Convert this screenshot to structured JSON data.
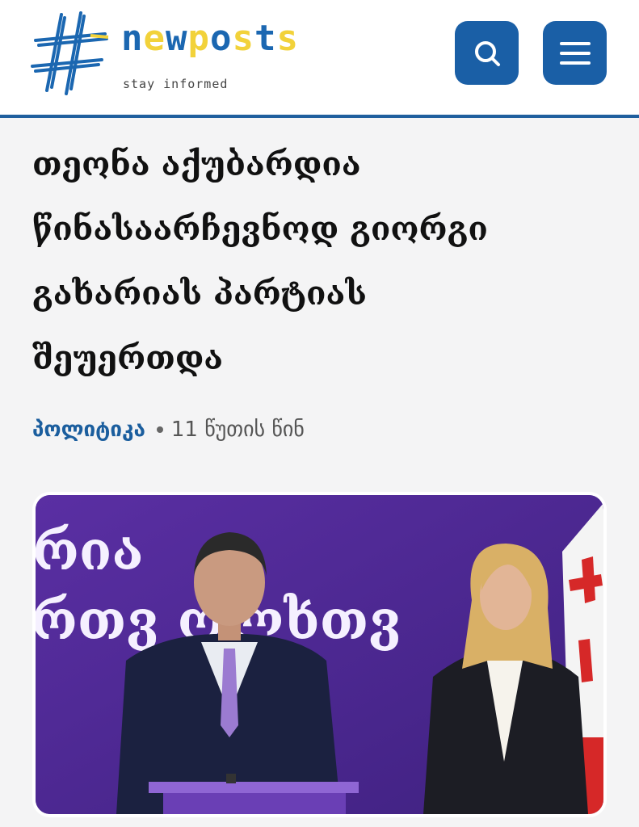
{
  "brand": {
    "name": "newposts",
    "tagline": "stay informed",
    "colors": {
      "blue": "#1b67b1",
      "yellow": "#f2d23a"
    }
  },
  "header": {
    "search_icon": "search-icon",
    "menu_icon": "hamburger-menu-icon",
    "accent": "#1a5fa6"
  },
  "article": {
    "title_lines": [
      "თეონა აქუბარდია",
      "წინასაარჩევნოდ გიორგი",
      "გახარიას პარტიას",
      "შეუერთდა"
    ],
    "category": "პოლიტიკა",
    "time_ago": "11 წუთის წინ"
  },
  "photo": {
    "backdrop_text_1": "რია",
    "backdrop_text_2": "რთვ ოლხთვ"
  }
}
